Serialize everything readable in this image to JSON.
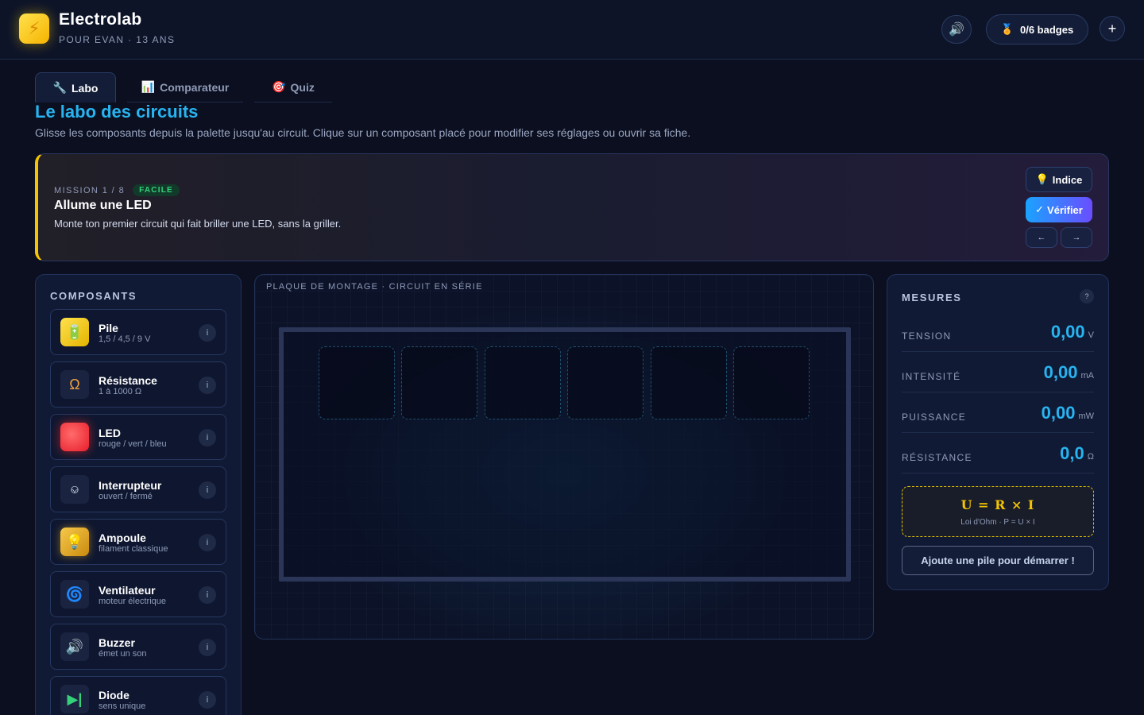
{
  "app": {
    "title": "Electrolab",
    "subtitle": "POUR EVAN · 13 ANS",
    "logo_icon": "lightning-icon",
    "badges_label": "0/6 badges",
    "plus_label": "+"
  },
  "tabs": [
    {
      "icon": "🔧",
      "label": "Labo",
      "active": true
    },
    {
      "icon": "📊",
      "label": "Comparateur",
      "active": false
    },
    {
      "icon": "🎯",
      "label": "Quiz",
      "active": false
    }
  ],
  "page": {
    "title": "Le labo des circuits",
    "description": "Glisse les composants depuis la palette jusqu'au circuit. Clique sur un composant placé pour modifier ses réglages ou ouvrir sa fiche."
  },
  "mission": {
    "meta": "MISSION 1 / 8",
    "difficulty": "FACILE",
    "title": "Allume une LED",
    "text": "Monte ton premier circuit qui fait briller une LED, sans la griller.",
    "hint_label": "Indice",
    "verify_label": "Vérifier",
    "prev_label": "←",
    "next_label": "→"
  },
  "palette": {
    "heading": "COMPOSANTS",
    "items": [
      {
        "name": "Pile",
        "sub": "1,5 / 4,5 / 9 V",
        "icon": "battery-icon",
        "glyph": "🔋"
      },
      {
        "name": "Résistance",
        "sub": "1 à 1000 Ω",
        "icon": "ohm-icon",
        "glyph": "Ω"
      },
      {
        "name": "LED",
        "sub": "rouge / vert / bleu",
        "icon": "led-icon",
        "glyph": ""
      },
      {
        "name": "Interrupteur",
        "sub": "ouvert / fermé",
        "icon": "switch-icon",
        "glyph": "⎉"
      },
      {
        "name": "Ampoule",
        "sub": "filament classique",
        "icon": "bulb-icon",
        "glyph": "💡"
      },
      {
        "name": "Ventilateur",
        "sub": "moteur électrique",
        "icon": "fan-icon",
        "glyph": "🌀"
      },
      {
        "name": "Buzzer",
        "sub": "émet un son",
        "icon": "speaker-icon",
        "glyph": "🔊"
      },
      {
        "name": "Diode",
        "sub": "sens unique",
        "icon": "diode-icon",
        "glyph": "▶|"
      }
    ],
    "info_label": "i"
  },
  "board": {
    "title": "PLAQUE DE MONTAGE · CIRCUIT EN SÉRIE",
    "slot_count": 6
  },
  "measures": {
    "heading": "MESURES",
    "help_label": "?",
    "rows": [
      {
        "label": "TENSION",
        "value": "0,00",
        "unit": "V"
      },
      {
        "label": "INTENSITÉ",
        "value": "0,00",
        "unit": "mA"
      },
      {
        "label": "PUISSANCE",
        "value": "0,00",
        "unit": "mW"
      },
      {
        "label": "RÉSISTANCE",
        "value": "0,0",
        "unit": "Ω"
      }
    ],
    "formula": "U = R × I",
    "formula_sub": "Loi d'Ohm · P = U × I",
    "start_label": "Ajoute une pile pour démarrer !"
  },
  "colors": {
    "accent": "#27b4f0",
    "warning": "#f5c400",
    "success": "#35d07a",
    "background": "#0b0f1f"
  }
}
